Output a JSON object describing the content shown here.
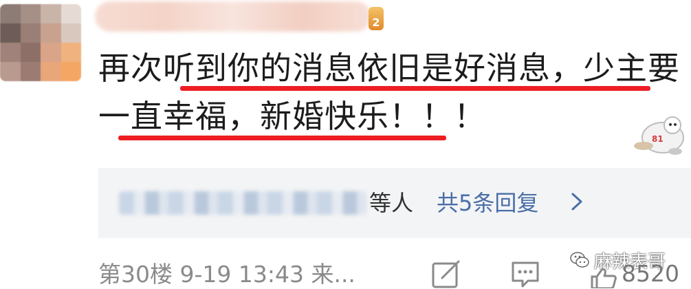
{
  "colors": {
    "underline": "#ee1d23",
    "reply_link": "#4a6ea6",
    "reply_bg": "#f3f4f6",
    "meta_text": "#8a8a8a"
  },
  "user": {
    "level_badge": "2"
  },
  "comment": {
    "line1": "再次听到你的消息依旧是好消息，少主要",
    "line2": "一直幸福，新婚快乐！！！"
  },
  "replies": {
    "suffix": "等人",
    "link": "共5条回复"
  },
  "footer": {
    "floor_time": "第30楼  9-19  13:43  来...",
    "watermark": "麻辣表哥",
    "like_count": "8520"
  },
  "icons": [
    "edit-icon",
    "comment-icon",
    "like-icon",
    "chevron-right-icon",
    "wechat-logo-icon",
    "sticker-icon"
  ]
}
